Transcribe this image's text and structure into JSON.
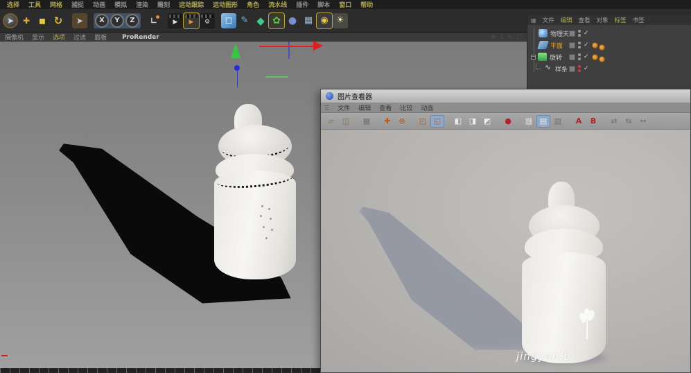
{
  "main_menubar": {
    "items": [
      "选择",
      "工具",
      "网格",
      "捕捉",
      "动画",
      "模拟",
      "渲染",
      "雕刻",
      "运动跟踪",
      "运动图形",
      "角色",
      "流水线",
      "插件",
      "脚本",
      "窗口",
      "帮助"
    ]
  },
  "main_toolbar": {
    "icons": [
      {
        "name": "live-selection",
        "glyph": "➤"
      },
      {
        "name": "move-tool",
        "glyph": "✚"
      },
      {
        "name": "scale-tool",
        "glyph": "◼"
      },
      {
        "name": "rotate-tool",
        "glyph": "↻"
      },
      {
        "name": "previous-tool",
        "glyph": "➤"
      },
      {
        "name": "lock-x-axis",
        "glyph": "X"
      },
      {
        "name": "lock-y-axis",
        "glyph": "Y"
      },
      {
        "name": "lock-z-axis",
        "glyph": "Z"
      },
      {
        "name": "coordinate-system",
        "glyph": "∟"
      },
      {
        "name": "render-active-view",
        "glyph": "▶"
      },
      {
        "name": "render-to-picture-viewer",
        "glyph": "▶"
      },
      {
        "name": "render-settings",
        "glyph": "⚙"
      },
      {
        "name": "add-primitive-cube",
        "glyph": "◻"
      },
      {
        "name": "draw-spline-pen",
        "glyph": "✎"
      },
      {
        "name": "subdivision-surface",
        "glyph": "◆"
      },
      {
        "name": "deformer",
        "glyph": "✿"
      },
      {
        "name": "volume-object",
        "glyph": "●"
      },
      {
        "name": "floor-environment",
        "glyph": "▦"
      },
      {
        "name": "camera",
        "glyph": "◉"
      },
      {
        "name": "light",
        "glyph": "☀"
      }
    ]
  },
  "viewport_menubar": {
    "items": [
      "摄像机",
      "显示",
      "选项",
      "过滤",
      "面板"
    ],
    "prorender_label": "ProRender"
  },
  "viewport_nav": {
    "pan_glyph": "✚",
    "zoom_glyph": "⇕",
    "rotate_glyph": "↻",
    "toggle_glyph": "▢"
  },
  "object_manager": {
    "menu_icon_glyph": "▦",
    "menu": [
      "文件",
      "编辑",
      "查看",
      "对象",
      "标签",
      "书签"
    ],
    "check_glyph": "✓",
    "expand_glyph": "−",
    "spline_glyph": "∿",
    "objects": [
      {
        "label": "物理天空"
      },
      {
        "label": "平面"
      },
      {
        "label": "旋转"
      },
      {
        "label": "样条"
      }
    ]
  },
  "picture_viewer": {
    "title": "图片查看器",
    "menu_icon_glyph": "☰",
    "menu": [
      "文件",
      "编辑",
      "查看",
      "比较",
      "动画"
    ],
    "toolbar_icons": [
      {
        "name": "open-file",
        "glyph": "▱"
      },
      {
        "name": "save-image",
        "glyph": "◫"
      },
      {
        "name": "histogram",
        "glyph": "▦"
      },
      {
        "name": "move-view",
        "glyph": "✚"
      },
      {
        "name": "zoom-view",
        "glyph": "⊙"
      },
      {
        "name": "zoom-100",
        "glyph": "◰"
      },
      {
        "name": "fullscreen",
        "glyph": "◱"
      },
      {
        "name": "fit-to-view",
        "glyph": "◧"
      },
      {
        "name": "fit-horizontal",
        "glyph": "◨"
      },
      {
        "name": "fit-vertical",
        "glyph": "◩"
      },
      {
        "name": "ram-player",
        "glyph": "●"
      },
      {
        "name": "single-view",
        "glyph": "▥"
      },
      {
        "name": "dual-view",
        "glyph": "▤"
      },
      {
        "name": "ab-compare",
        "glyph": "▧"
      },
      {
        "name": "set-as-a",
        "glyph": "A"
      },
      {
        "name": "set-as-b",
        "glyph": "B"
      },
      {
        "name": "swap-ab",
        "glyph": "⇄"
      },
      {
        "name": "link-ab",
        "glyph": "⇆"
      },
      {
        "name": "offset-ab",
        "glyph": "↔"
      }
    ],
    "watermark": "jingyan.b"
  }
}
